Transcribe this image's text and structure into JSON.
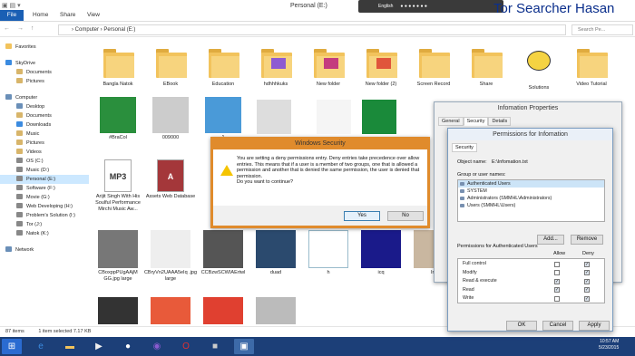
{
  "ribbon": {
    "tabs": [
      "File",
      "Home",
      "Share",
      "View"
    ],
    "title": "Personal (E:)",
    "brand": "Tor Searcher Hasan",
    "language": "English"
  },
  "address": {
    "path": "› Computer › Personal (E:)",
    "search_placeholder": "Search Pe..."
  },
  "nav": {
    "items": [
      {
        "label": "Favorites",
        "level": 0
      },
      {
        "label": "SkyDrive",
        "level": 0
      },
      {
        "label": "Documents",
        "level": 1
      },
      {
        "label": "Pictures",
        "level": 1
      },
      {
        "label": "Computer",
        "level": 0
      },
      {
        "label": "Desktop",
        "level": 1
      },
      {
        "label": "Documents",
        "level": 1
      },
      {
        "label": "Downloads",
        "level": 1
      },
      {
        "label": "Music",
        "level": 1
      },
      {
        "label": "Pictures",
        "level": 1
      },
      {
        "label": "Videos",
        "level": 1
      },
      {
        "label": "OS (C:)",
        "level": 1
      },
      {
        "label": "Music (D:)",
        "level": 1
      },
      {
        "label": "Personal (E:)",
        "level": 1,
        "selected": true
      },
      {
        "label": "Software (F:)",
        "level": 1
      },
      {
        "label": "Movie (G:)",
        "level": 1
      },
      {
        "label": "Web Developing (H:)",
        "level": 1
      },
      {
        "label": "Problem's Solution (I:)",
        "level": 1
      },
      {
        "label": "Tor (J:)",
        "level": 1
      },
      {
        "label": "Natok (K:)",
        "level": 1
      },
      {
        "label": "Network",
        "level": 0
      }
    ]
  },
  "files": {
    "row1": [
      "Bangla Natok",
      "EBook",
      "Education",
      "hdhhhkuks",
      "New folder",
      "New folder (2)",
      "Screen Record",
      "Share",
      "Solutions",
      "Video Tutorial"
    ],
    "row2": [
      "#BraCol",
      "009000",
      "1"
    ],
    "row3": [
      "Arijit Singh With His Soulful Performance Mirchi Music Aw...",
      "Assets Web Database"
    ],
    "row4": [
      "CBoxppPUgAAjM GG.jpg large",
      "CBryVn2UAAA5eIq .jpg large",
      "CCBzwSCWIAErtwl",
      "duad",
      "h",
      "icq",
      "Inf"
    ]
  },
  "status": {
    "count": "87 items",
    "selected": "1 item selected  7.17 KB"
  },
  "clock": {
    "time": "10:57 AM",
    "date": "5/23/2015"
  },
  "security_dialog": {
    "title": "Windows Security",
    "message": "You are setting a deny permissions entry. Deny entries take precedence over allow entries. This means that if a user is a member of two groups, one that is allowed a permission and another that is denied the same permission, the user is denied that permission.",
    "question": "Do you want to continue?",
    "yes": "Yes",
    "no": "No"
  },
  "info_dialog": {
    "title": "Infomation Properties",
    "tabs": [
      "General",
      "Security",
      "Details"
    ]
  },
  "perm_dialog": {
    "title": "Permissions for Infomation",
    "tab": "Security",
    "object_label": "Object name:",
    "object_value": "E:\\Infomation.txt",
    "group_label": "Group or user names:",
    "users": [
      "Authenticated Users",
      "SYSTEM",
      "Administrators (SMMHL\\Administrators)",
      "Users (SMMHL\\Users)"
    ],
    "add": "Add...",
    "remove": "Remove",
    "perm_header": "Permissions for Authenticated Users",
    "allow": "Allow",
    "deny": "Deny",
    "perms": [
      {
        "name": "Full control",
        "allow": false,
        "deny": true
      },
      {
        "name": "Modify",
        "allow": false,
        "deny": true
      },
      {
        "name": "Read & execute",
        "allow": true,
        "deny": true
      },
      {
        "name": "Read",
        "allow": true,
        "deny": true
      },
      {
        "name": "Write",
        "allow": false,
        "deny": true
      }
    ],
    "ok": "OK",
    "cancel": "Cancel",
    "apply": "Apply"
  },
  "colors": {
    "accent": "#1a5fb4",
    "folder": "#f2c35c",
    "taskbar": "#1c3f78",
    "warning": "#e08b2c"
  }
}
